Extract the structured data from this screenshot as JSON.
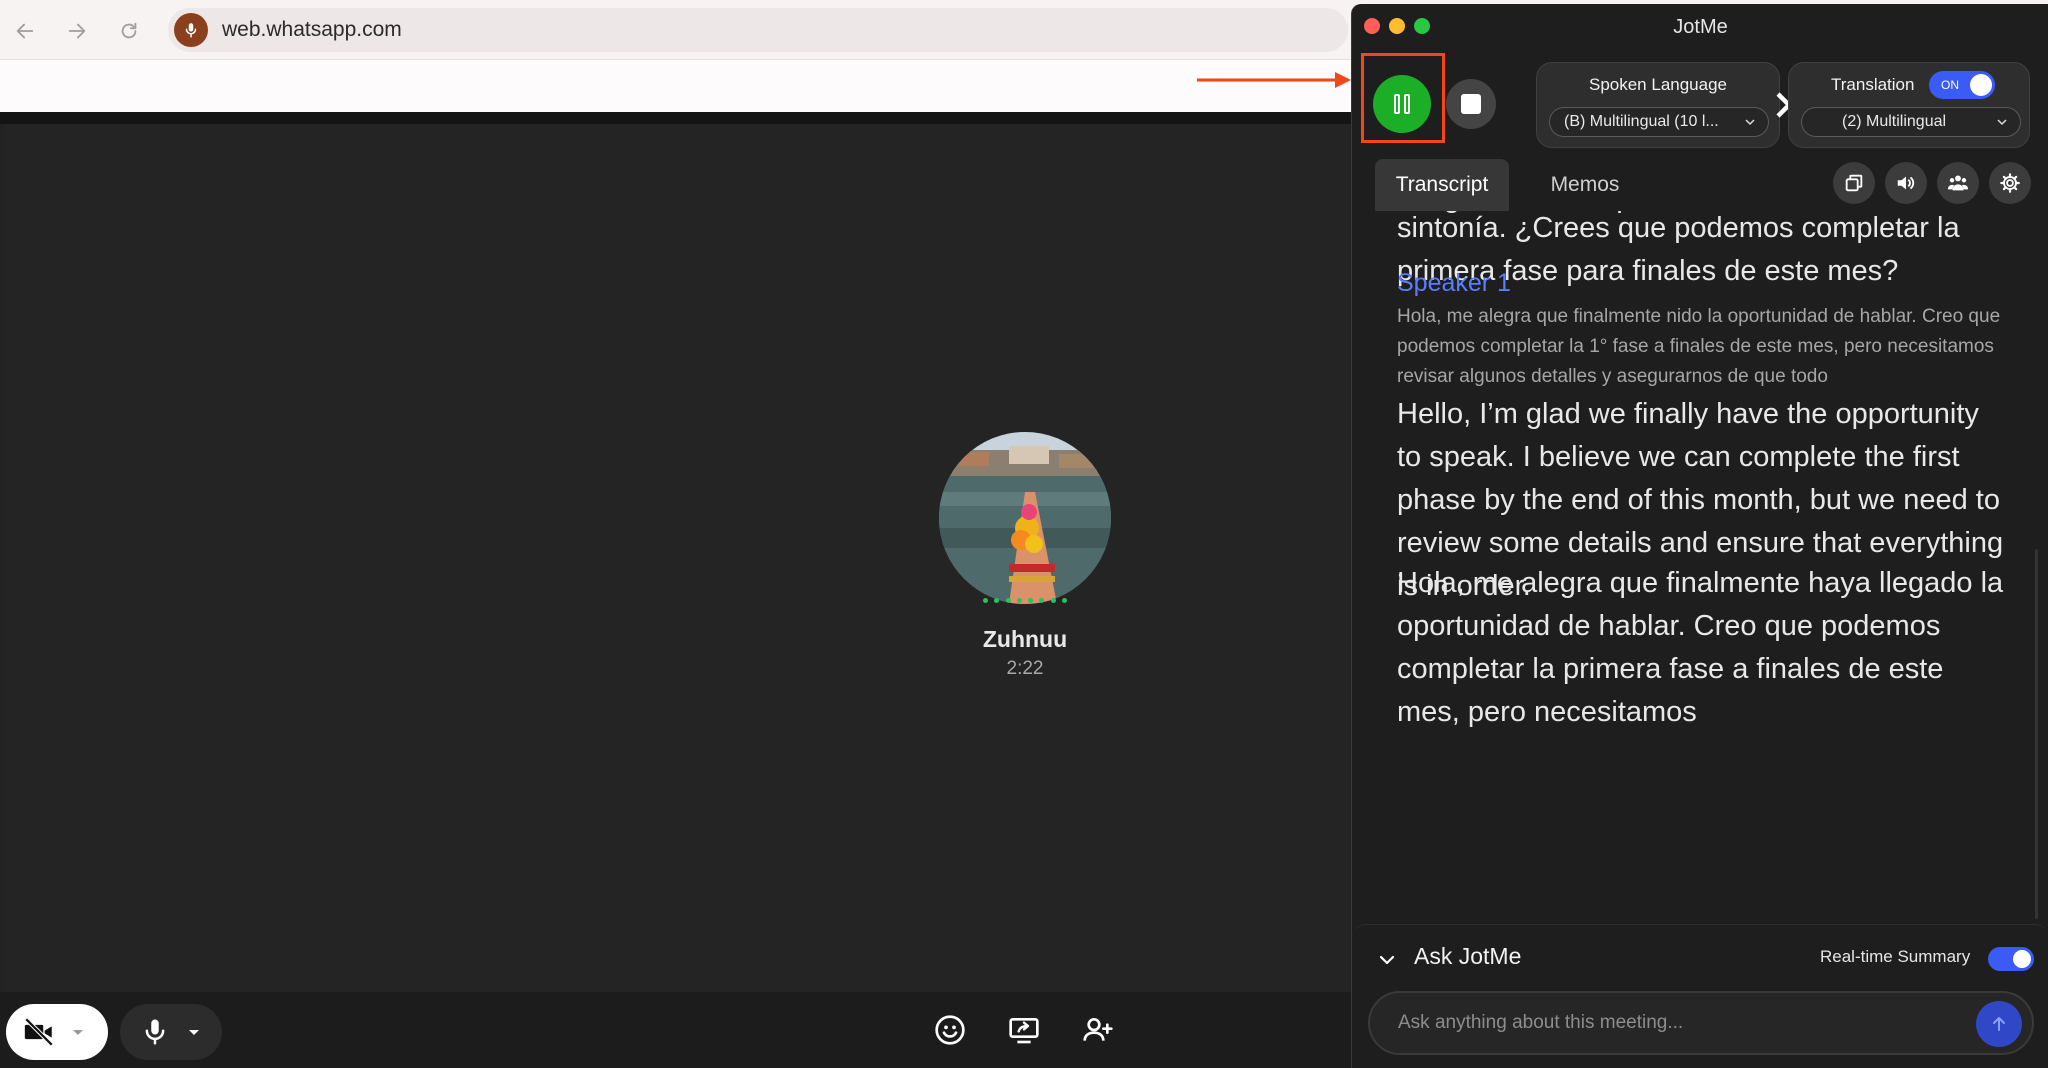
{
  "browser": {
    "url": "web.whatsapp.com",
    "back_icon": "arrow-left-icon",
    "forward_icon": "arrow-right-icon",
    "reload_icon": "reload-icon",
    "site_icon": "microphone-icon"
  },
  "call": {
    "contact_name": "Zuhnuu",
    "duration": "2:22",
    "toolbar_icons": [
      "camera-off-icon",
      "microphone-icon",
      "emoji-icon",
      "screen-share-icon",
      "add-person-icon"
    ]
  },
  "jotme": {
    "title": "JotMe",
    "spoken_language": {
      "label": "Spoken Language",
      "value": "(B) Multilingual (10 l..."
    },
    "translation": {
      "label": "Translation",
      "toggle": "ON",
      "value": "(2) Multilingual"
    },
    "tabs": [
      {
        "label": "Transcript",
        "active": true
      },
      {
        "label": "Memos",
        "active": false
      }
    ],
    "toolbar_icons": [
      "copy-icon",
      "speaker-icon",
      "people-icon",
      "settings-icon"
    ],
    "transcript": {
      "partial_top_line": "asegurarnos de que estamos en la misma",
      "top_text": "sintonía. ¿Crees que podemos completar la primera fase para finales de este mes?",
      "speaker": "Speaker 1",
      "original": "Hola, me alegra que finalmente nido la oportunidad de hablar. Creo que podemos completar la 1° fase a finales de este mes, pero necesitamos revisar algunos detalles y asegurarnos de que todo",
      "translation": "Hello, I’m glad we finally have the opportunity to speak. I believe we can complete the first phase by the end of this month, but we need to review some details and ensure that everything is in order.",
      "refined": "Hola, me alegra que finalmente haya llegado la oportunidad de hablar. Creo que podemos completar la primera fase a finales de este mes, pero necesitamos"
    },
    "ask": {
      "title": "Ask JotMe",
      "summary_label": "Real-time Summary",
      "placeholder": "Ask anything about this meeting..."
    }
  },
  "colors": {
    "record_green": "#1dae27",
    "accent_blue": "#3b5bf6",
    "speaker_blue": "#5b7cff",
    "annotation_orange": "#f1471a"
  }
}
